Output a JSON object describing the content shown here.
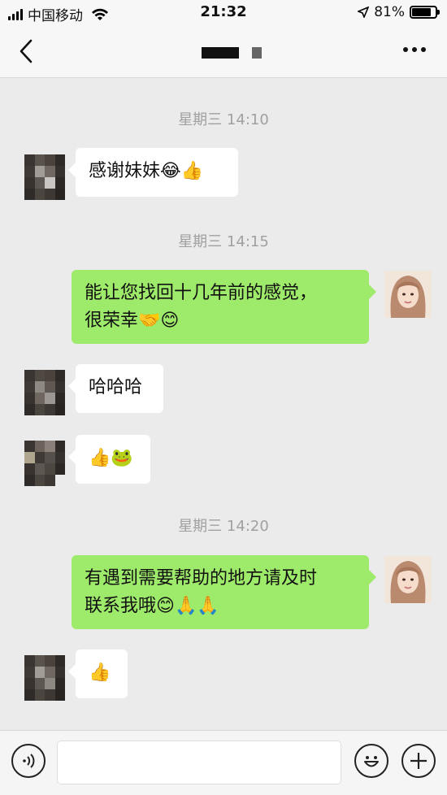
{
  "status_bar": {
    "carrier": "中国移动",
    "time": "21:32",
    "battery_percent": "81%",
    "battery_level": 0.81
  },
  "nav": {
    "back_icon": "chevron-left-icon",
    "more_icon": "more-dots-icon"
  },
  "messages": [
    {
      "type": "time",
      "text": "星期三 14:10"
    },
    {
      "type": "incoming",
      "text": "感谢妹妹",
      "emoji": "😂👍"
    },
    {
      "type": "time",
      "text": "星期三 14:15"
    },
    {
      "type": "outgoing",
      "line1": "能让您找回十几年前的感觉，",
      "line2": "很荣幸",
      "emoji": "🤝😊"
    },
    {
      "type": "incoming",
      "text": "哈哈哈"
    },
    {
      "type": "incoming",
      "emoji": "👍🐸"
    },
    {
      "type": "time",
      "text": "星期三 14:20"
    },
    {
      "type": "outgoing",
      "line1": "有遇到需要帮助的地方请及时",
      "line2": "联系我哦",
      "emoji": "😊🙏🙏"
    },
    {
      "type": "incoming",
      "emoji": "👍"
    }
  ],
  "input": {
    "value": "",
    "voice_icon": "voice-icon",
    "emoji_icon": "emoji-icon",
    "add_icon": "plus-icon"
  }
}
